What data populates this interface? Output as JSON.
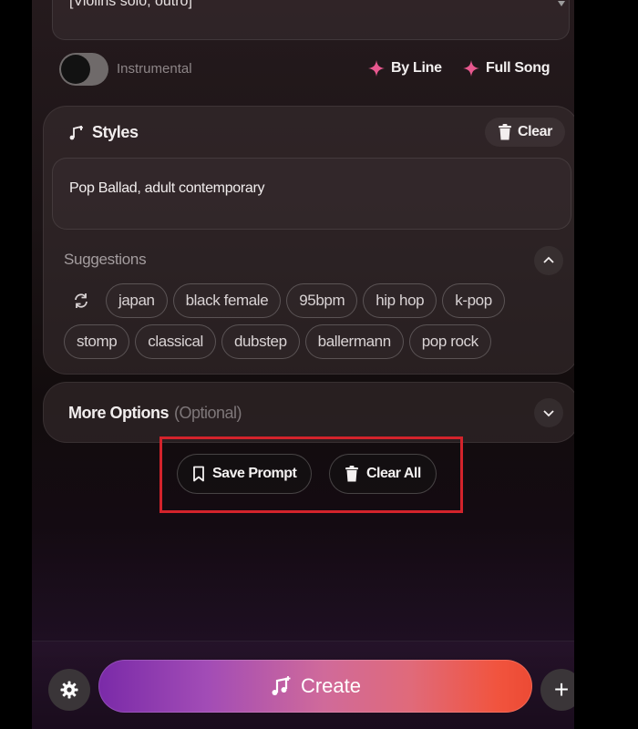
{
  "lyrics": {
    "visible_text": "[Violins solo, outro]"
  },
  "controls": {
    "instrumental_label": "Instrumental",
    "instrumental_on": false,
    "by_line_label": "By Line",
    "full_song_label": "Full Song"
  },
  "styles": {
    "title": "Styles",
    "clear_label": "Clear",
    "value": "Pop Ballad, adult contemporary",
    "suggestions_label": "Suggestions",
    "suggestions_row1": [
      "japan",
      "black female",
      "95bpm",
      "hip hop",
      "k-pop"
    ],
    "suggestions_row2": [
      "stomp",
      "classical",
      "dubstep",
      "ballermann",
      "pop rock"
    ]
  },
  "more_options": {
    "title": "More Options",
    "optional": "(Optional)"
  },
  "actions": {
    "save_prompt": "Save Prompt",
    "clear_all": "Clear All"
  },
  "bottom": {
    "create_label": "Create",
    "plus": "+"
  },
  "colors": {
    "accent_pink": "#e8588f",
    "create_gradient_start": "#7a2aa8",
    "create_gradient_end": "#ec4a34",
    "highlight_border": "#d3232b"
  }
}
